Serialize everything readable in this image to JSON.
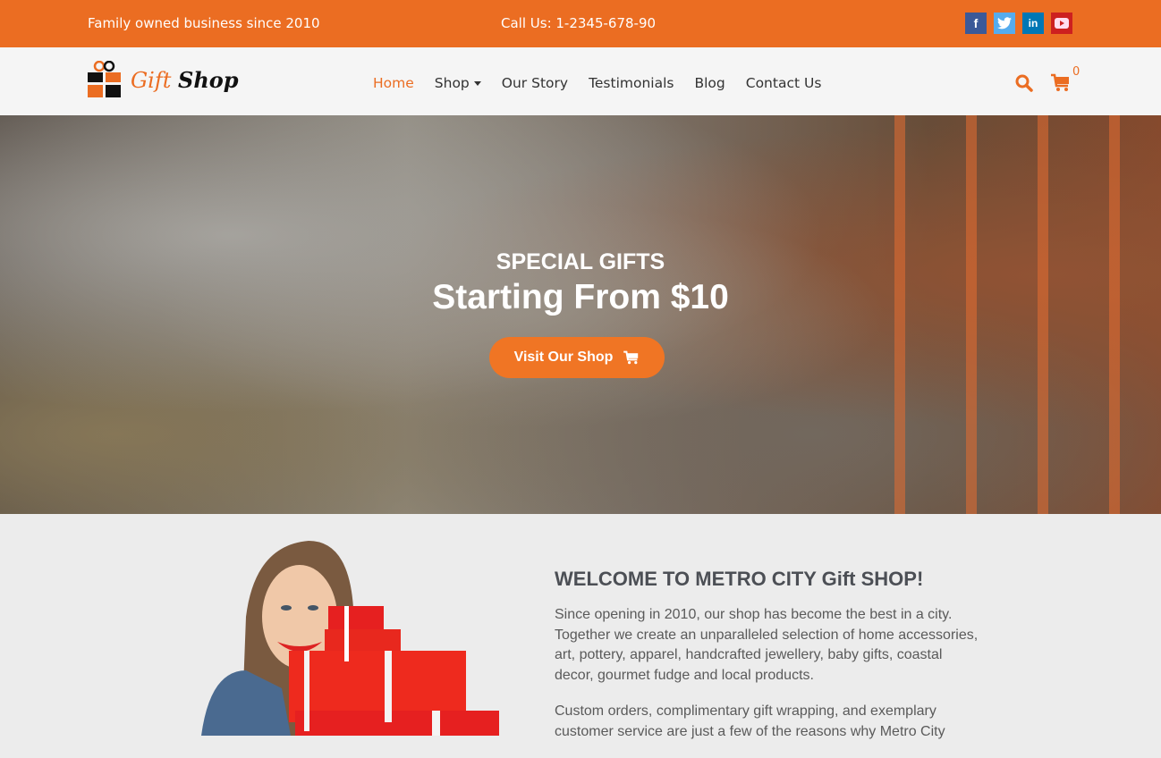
{
  "topbar": {
    "tagline": "Family owned business since 2010",
    "phone": "Call Us: 1-2345-678-90",
    "socials": [
      {
        "name": "facebook",
        "glyph": "f"
      },
      {
        "name": "twitter",
        "glyph": "t"
      },
      {
        "name": "linkedin",
        "glyph": "in"
      },
      {
        "name": "youtube",
        "glyph": "▶"
      }
    ]
  },
  "navbar": {
    "logo": {
      "word1": "Gift",
      "word2": "Shop"
    },
    "menu": [
      {
        "label": "Home",
        "active": true
      },
      {
        "label": "Shop",
        "has_dropdown": true
      },
      {
        "label": "Our Story"
      },
      {
        "label": "Testimonials"
      },
      {
        "label": "Blog"
      },
      {
        "label": "Contact Us"
      }
    ],
    "cart_count": "0"
  },
  "hero": {
    "subtitle": "SPECIAL GIFTS",
    "title": "Starting From $10",
    "button_label": "Visit Our Shop"
  },
  "welcome": {
    "title": "WELCOME TO METRO CITY Gift SHOP!",
    "paragraphs": [
      "Since opening in 2010, our shop has become the best in a city. Together we create an unparalleled selection of home accessories, art, pottery, apparel, handcrafted jewellery, baby gifts, coastal decor, gourmet fudge and local products.",
      "Custom orders, complimentary gift wrapping, and exemplary customer service are just a few of the reasons why Metro City"
    ]
  },
  "colors": {
    "accent": "#eb6d22",
    "button": "#f07524",
    "heading": "#4c4f55"
  }
}
